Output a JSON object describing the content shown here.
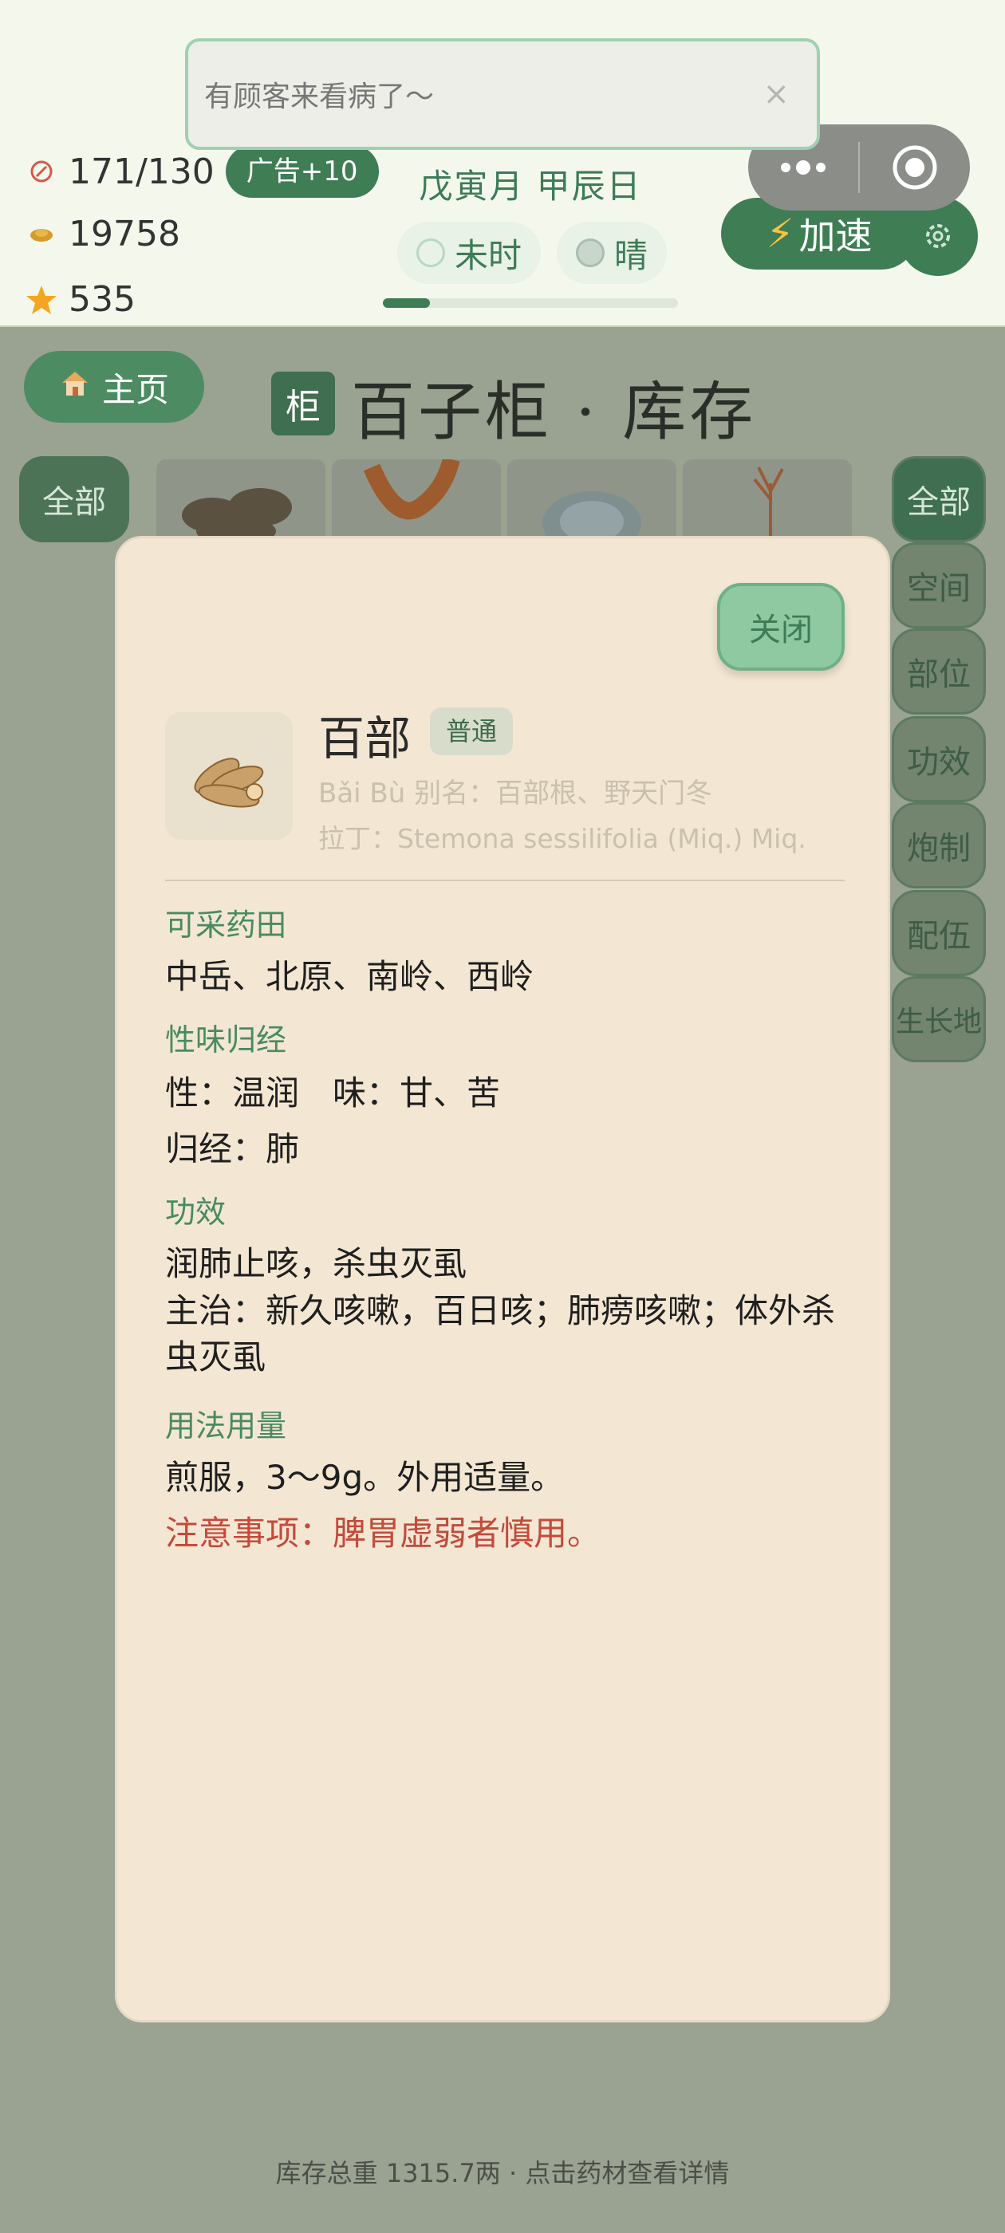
{
  "toast": {
    "text": "有顾客来看病了～",
    "close": "×"
  },
  "stats": {
    "stamina": "171/130",
    "ad_bonus": "广告+10",
    "coins": "19758",
    "stars": "535"
  },
  "calendar": {
    "date": "戊寅月 甲辰日",
    "hour": "未时",
    "weather": "晴",
    "day_progress": 0.16
  },
  "controls": {
    "speed_label": "加速",
    "settings_icon": "gear-icon",
    "capsule_more": "more-dots-icon",
    "capsule_close": "target-icon"
  },
  "page": {
    "home_label": "主页",
    "cabinet_tag": "柜",
    "title": "百子柜 · 库存",
    "left_category": "全部",
    "right_categories": [
      "全部",
      "空间",
      "部位",
      "功效",
      "炮制",
      "配伍",
      "生长地"
    ],
    "footer": "库存总重 1315.7两 · 点击药材查看详情"
  },
  "modal": {
    "close_label": "关闭",
    "name": "百部",
    "rarity": "普通",
    "pinyin_alias": "Bǎi Bù  别名：百部根、野天门冬",
    "latin": "拉丁：Stemona sessilifolia (Miq.) Miq.",
    "fields_title": "可采药田",
    "fields": "中岳、北原、南岭、西岭",
    "nature_title": "性味归经",
    "nature": "性：温润　味：甘、苦",
    "meridian": "归经：肺",
    "effect_title": "功效",
    "effect": "润肺止咳，杀虫灭虱",
    "indication": "主治：新久咳嗽，百日咳；肺痨咳嗽；体外杀虫灭虱",
    "usage_title": "用法用量",
    "usage": "煎服，3～9g。外用适量。",
    "caution": "注意事项：脾胃虚弱者慎用。"
  },
  "colors": {
    "brand_green": "#3f7d55",
    "modal_bg": "#f3e7d3",
    "section_title": "#4a8a61",
    "warning": "#c44a3c"
  }
}
